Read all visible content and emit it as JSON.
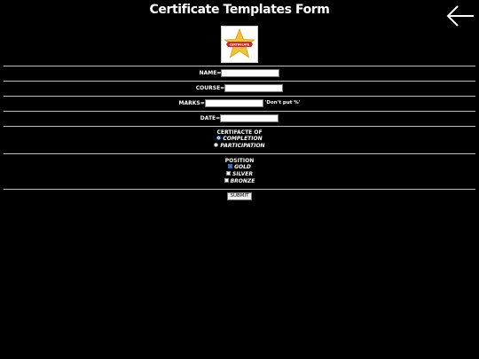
{
  "header": {
    "title": "Certificate Templates Form",
    "back_icon": "arrow-left-icon"
  },
  "logo": {
    "icon": "gold-star-ribbon-logo",
    "ribbon_text": "CERTIFICATE",
    "colors": {
      "star": "#f2c230",
      "ribbon": "#c62828"
    }
  },
  "form": {
    "name_label": "NAME=",
    "name_value": "",
    "course_label": "COURSE=",
    "course_value": "",
    "marks_label": "MARKS=",
    "marks_value": "",
    "marks_hint": "'Don't put %'",
    "date_label": "DATE=",
    "date_value": "",
    "certificate_heading": "CERTIFACTE OF",
    "certificate_options": [
      {
        "label": "COMPLETION",
        "selected": true
      },
      {
        "label": "PARTICIPATION",
        "selected": false
      }
    ],
    "position_heading": "POSITION",
    "position_options": [
      {
        "label": "GOLD",
        "checked": true
      },
      {
        "label": "SILVER",
        "checked": false
      },
      {
        "label": "BRONZE",
        "checked": false
      }
    ],
    "submit_label": "SUBMIT"
  },
  "colors": {
    "background": "#000000",
    "text": "#ffffff",
    "accent": "#1a73e8"
  }
}
